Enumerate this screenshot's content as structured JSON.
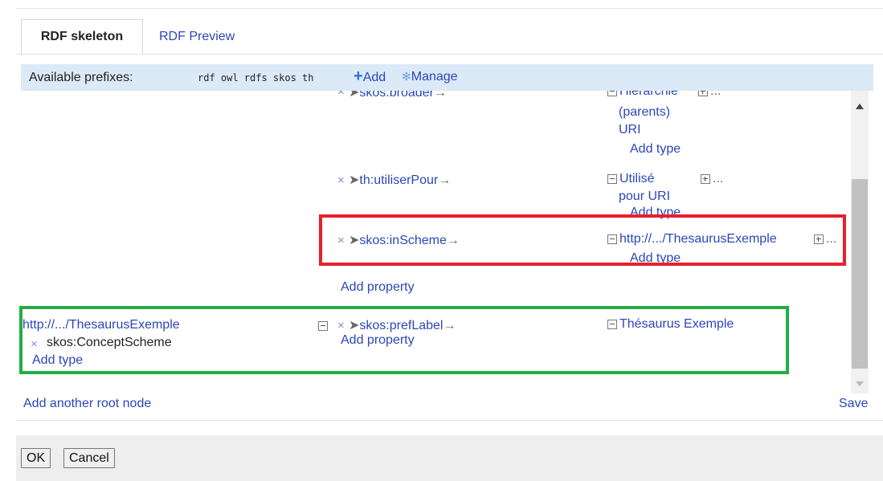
{
  "tabs": {
    "skeleton": "RDF skeleton",
    "preview": "RDF Preview"
  },
  "prefixes": {
    "label": "Available prefixes:",
    "list": "rdf owl rdfs skos th",
    "add": "Add",
    "manage": "Manage"
  },
  "rows": {
    "broader": {
      "property": "skos:broader",
      "target_lines": [
        "Hierarchie",
        "(parents)",
        "URI"
      ],
      "add_type": "Add type"
    },
    "utiliser": {
      "property": "th:utiliserPour",
      "target_lines": [
        "Utilisé",
        "pour URI"
      ],
      "add_type": "Add type"
    },
    "inscheme": {
      "property": "skos:inScheme",
      "target": "http://.../ThesaurusExemple",
      "add_type": "Add type"
    },
    "add_property": "Add property"
  },
  "root2": {
    "subject": "http://.../ThesaurusExemple",
    "type": "skos:ConceptScheme",
    "add_type": "Add type",
    "property": "skos:prefLabel",
    "add_property": "Add property",
    "target": "Thésaurus Exemple"
  },
  "actions": {
    "add_root": "Add another root node",
    "save": "Save"
  },
  "buttons": {
    "ok": "OK",
    "cancel": "Cancel"
  },
  "glyphs": {
    "x": "×",
    "prop_prefix": "➤",
    "arrow": "→",
    "ellipsis": "..."
  },
  "colors": {
    "highlight_red": "#e8202c",
    "highlight_green": "#25ad45",
    "prefix_bar": "#dce9f7",
    "link": "#2c46b8"
  }
}
